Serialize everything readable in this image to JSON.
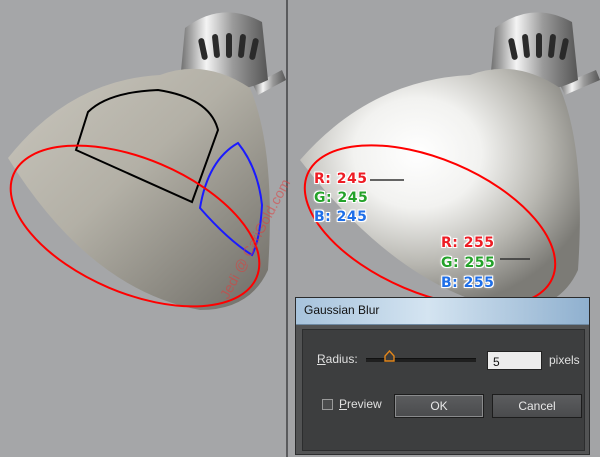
{
  "left_panel": {
    "watermark": "Jedi @ CariGold.com"
  },
  "right_panel": {
    "sample1": {
      "r": "R: 245",
      "g": "G: 245",
      "b": "B: 245"
    },
    "sample2": {
      "r": "R: 255",
      "g": "G: 255",
      "b": "B: 255"
    }
  },
  "dialog": {
    "title": "Gaussian Blur",
    "radius_label": "Radius:",
    "radius_value": "5",
    "unit": "pixels",
    "preview_label": "Preview",
    "preview_checked": false,
    "ok_label": "OK",
    "cancel_label": "Cancel"
  },
  "colors": {
    "outline_red": "#ff0000",
    "outline_blue": "#1a1aff",
    "outline_black": "#000000"
  }
}
